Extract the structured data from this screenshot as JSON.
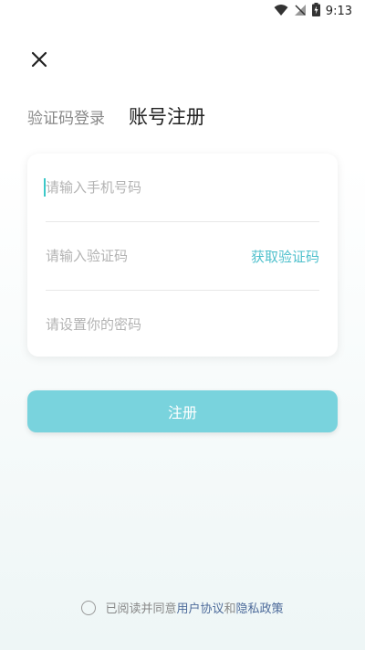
{
  "status_bar": {
    "time": "9:13"
  },
  "tabs": {
    "sms_login": "验证码登录",
    "account_register": "账号注册"
  },
  "form": {
    "phone_placeholder": "请输入手机号码",
    "code_placeholder": "请输入验证码",
    "get_code_label": "获取验证码",
    "password_placeholder": "请设置你的密码"
  },
  "register_button": "注册",
  "agreement": {
    "prefix": "已阅读并同意",
    "user_agreement": "用户协议",
    "and": "和",
    "privacy_policy": "隐私政策"
  },
  "colors": {
    "accent": "#79d3dd",
    "link_teal": "#4fc0cc",
    "link_blue": "#4c6a9a"
  }
}
